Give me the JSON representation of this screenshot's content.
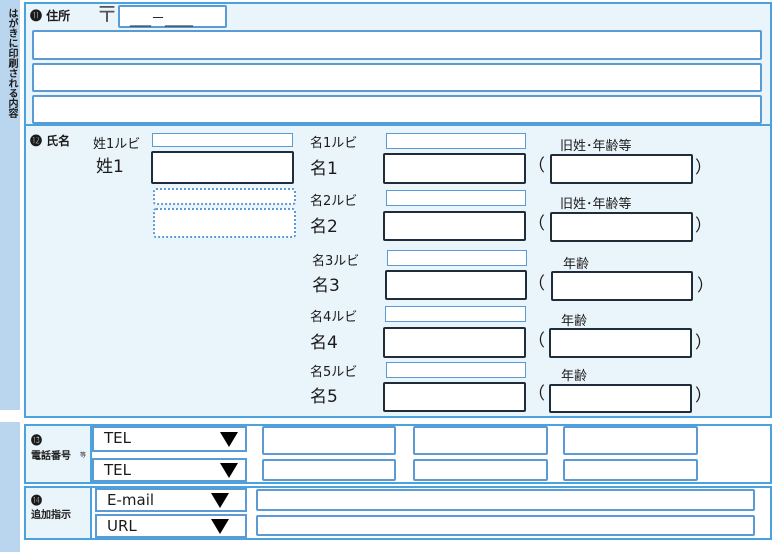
{
  "side_label": "はがきに印刷される内容",
  "address": {
    "section_label": "⓫ 住所",
    "postal_mark": "〒",
    "postal_placeholder": "___－____"
  },
  "name": {
    "section_label": "⓬ 氏名",
    "sei1_ruby_label": "姓1ルビ",
    "sei1_label": "姓1",
    "rows": [
      {
        "ruby_label": "名1ルビ",
        "label": "名1",
        "paren_open": "（",
        "paren_close": "）",
        "extra_label": "旧姓･年齢等"
      },
      {
        "ruby_label": "名2ルビ",
        "label": "名2",
        "paren_open": "（",
        "paren_close": "）",
        "extra_label": "旧姓･年齢等"
      },
      {
        "ruby_label": "名3ルビ",
        "label": "名3",
        "paren_open": "（",
        "paren_close": "）",
        "extra_label": "年齢"
      },
      {
        "ruby_label": "名4ルビ",
        "label": "名4",
        "paren_open": "（",
        "paren_close": "）",
        "extra_label": "年齢"
      },
      {
        "ruby_label": "名5ルビ",
        "label": "名5",
        "paren_open": "（",
        "paren_close": "）",
        "extra_label": "年齢"
      }
    ]
  },
  "phone": {
    "section_label_num": "⓭",
    "section_label": "電話番号",
    "section_suffix": "等",
    "select1": "TEL",
    "select2": "TEL"
  },
  "extra": {
    "section_label_num": "⓮",
    "section_label": "追加指示",
    "select1": "E-mail",
    "select2": "URL"
  },
  "colors": {
    "accent": "#4aa3df",
    "panel_bg": "#eaf4fb",
    "side_strip": "#b9d6ee",
    "field_border": "#5b9bd5",
    "dark_border": "#1f2d3a"
  },
  "icons": {
    "dropdown": "triangle-down-icon"
  }
}
